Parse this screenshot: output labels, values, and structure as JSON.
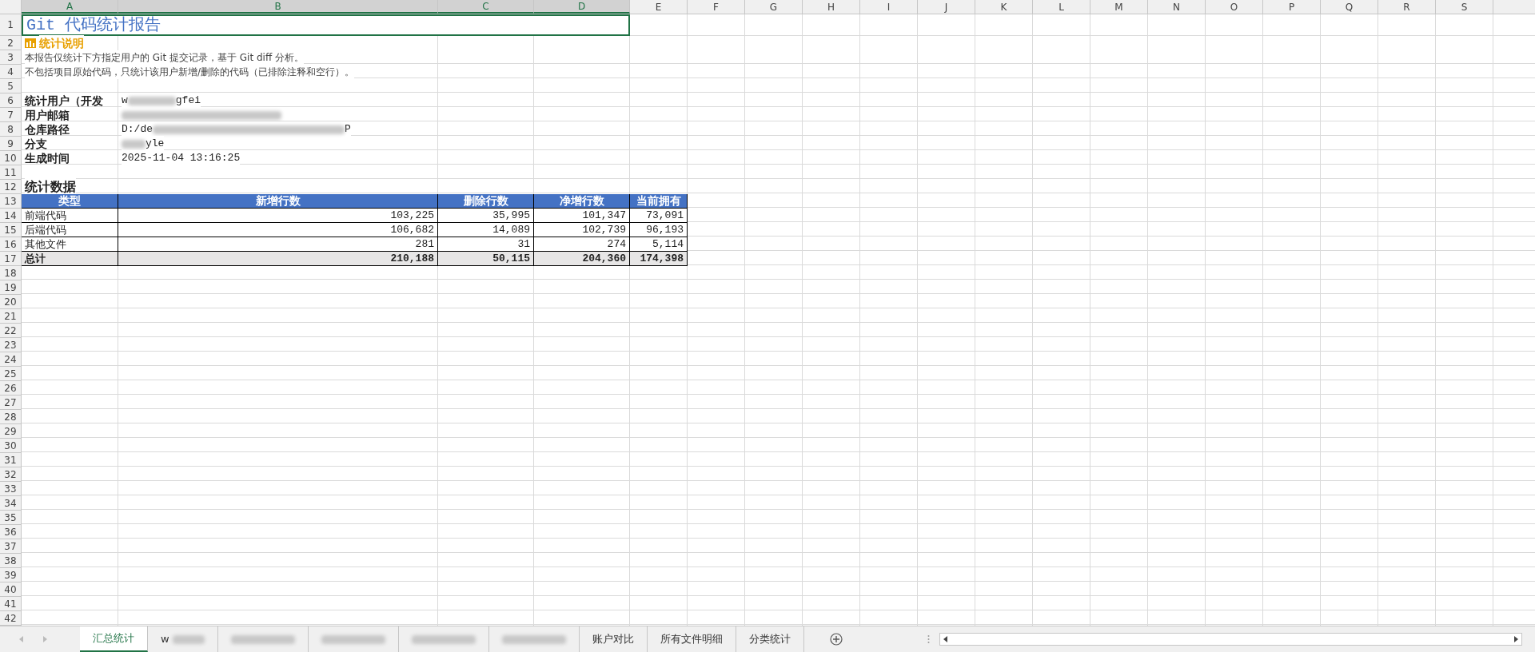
{
  "column_headers": [
    {
      "label": "A",
      "selected": true
    },
    {
      "label": "B",
      "selected": true
    },
    {
      "label": "C",
      "selected": true
    },
    {
      "label": "D",
      "selected": true
    },
    {
      "label": "E",
      "selected": false
    },
    {
      "label": "F",
      "selected": false
    },
    {
      "label": "G",
      "selected": false
    },
    {
      "label": "H",
      "selected": false
    },
    {
      "label": "I",
      "selected": false
    },
    {
      "label": "J",
      "selected": false
    },
    {
      "label": "K",
      "selected": false
    },
    {
      "label": "L",
      "selected": false
    },
    {
      "label": "M",
      "selected": false
    },
    {
      "label": "N",
      "selected": false
    },
    {
      "label": "O",
      "selected": false
    },
    {
      "label": "P",
      "selected": false
    },
    {
      "label": "Q",
      "selected": false
    },
    {
      "label": "R",
      "selected": false
    },
    {
      "label": "S",
      "selected": false
    }
  ],
  "row_headers": [
    "1",
    "2",
    "3",
    "4",
    "5",
    "6",
    "7",
    "8",
    "9",
    "10",
    "11",
    "12",
    "13",
    "14",
    "15",
    "16",
    "17",
    "18",
    "19",
    "20",
    "21",
    "22",
    "23",
    "24",
    "25",
    "26",
    "27",
    "28",
    "29",
    "30",
    "31",
    "32",
    "33",
    "34",
    "35",
    "36",
    "37",
    "38",
    "39",
    "40",
    "41",
    "42"
  ],
  "title": "Git 代码统计报告",
  "section_title": "统计说明",
  "notes": [
    "本报告仅统计下方指定用户的 Git 提交记录，基于 Git diff 分析。",
    "不包括项目原始代码，只统计该用户新增/删除的代码（已排除注释和空行）。"
  ],
  "info": [
    {
      "label": "统计用户（开发",
      "value": "w",
      "value_tail": "gfei",
      "redacted": true
    },
    {
      "label": "用户邮箱",
      "redacted": true
    },
    {
      "label": "仓库路径",
      "value": "D:/de",
      "value_tail": "P",
      "redacted": true
    },
    {
      "label": "分支",
      "value_tail": "yle",
      "redacted": true
    },
    {
      "label": "生成时间",
      "value": "2025-11-04 13:16:25",
      "redacted": false
    }
  ],
  "stats_title": "统计数据",
  "table": {
    "columns": [
      "类型",
      "新增行数",
      "删除行数",
      "净增行数",
      "当前拥有"
    ],
    "rows": [
      {
        "kind": "data",
        "cells": [
          "前端代码",
          "103,225",
          "35,995",
          "101,347",
          "73,091"
        ]
      },
      {
        "kind": "data",
        "cells": [
          "后端代码",
          "106,682",
          "14,089",
          "102,739",
          "96,193"
        ]
      },
      {
        "kind": "data",
        "cells": [
          "其他文件",
          "281",
          "31",
          "274",
          "5,114"
        ]
      },
      {
        "kind": "total",
        "cells": [
          "总计",
          "210,188",
          "50,115",
          "204,360",
          "174,398"
        ]
      }
    ]
  },
  "sheet_tabs": [
    {
      "kind": "text",
      "label": "汇总统计",
      "selected": true
    },
    {
      "kind": "redacted",
      "label": "w",
      "selected": false
    },
    {
      "kind": "redacted",
      "selected": false
    },
    {
      "kind": "redacted",
      "selected": false
    },
    {
      "kind": "redacted",
      "selected": false
    },
    {
      "kind": "redacted",
      "selected": false
    },
    {
      "kind": "text",
      "label": "账户对比",
      "selected": false
    },
    {
      "kind": "text",
      "label": "所有文件明细",
      "selected": false
    },
    {
      "kind": "text",
      "label": "分类统计",
      "selected": false
    }
  ]
}
